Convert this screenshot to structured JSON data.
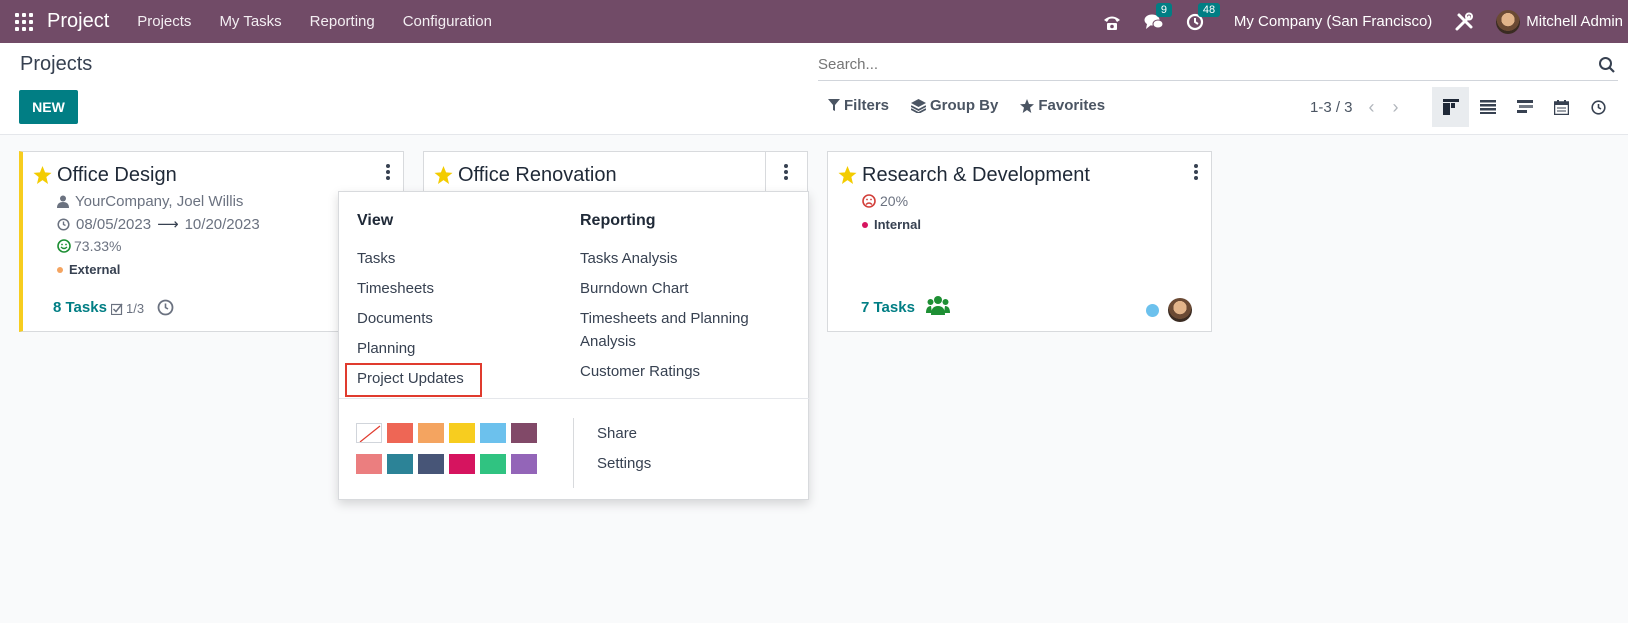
{
  "navbar": {
    "brand": "Project",
    "menu": [
      "Projects",
      "My Tasks",
      "Reporting",
      "Configuration"
    ],
    "messages_count": "9",
    "activities_count": "48",
    "company": "My Company (San Francisco)",
    "user": "Mitchell Admin",
    "color": "#714b67"
  },
  "control": {
    "title": "Projects",
    "new_label": "NEW",
    "search_placeholder": "Search...",
    "filters_label": "Filters",
    "groupby_label": "Group By",
    "favorites_label": "Favorites",
    "pager": "1-3 / 3"
  },
  "cards": [
    {
      "title": "Office Design",
      "customer": "YourCompany, Joel Willis",
      "date_start": "08/05/2023",
      "date_end": "10/20/2023",
      "rating": "73.33%",
      "tag": "External",
      "tasks": "8 Tasks",
      "milestones": "1/3"
    },
    {
      "title": "Office Renovation"
    },
    {
      "title": "Research & Development",
      "rating": "20%",
      "tag": "Internal",
      "tasks": "7 Tasks"
    }
  ],
  "dropdown": {
    "view_heading": "View",
    "view_items": [
      "Tasks",
      "Timesheets",
      "Documents",
      "Planning",
      "Project Updates"
    ],
    "reporting_heading": "Reporting",
    "reporting_items": [
      "Tasks Analysis",
      "Burndown Chart",
      "Timesheets and Planning Analysis",
      "Customer Ratings"
    ],
    "share_label": "Share",
    "settings_label": "Settings",
    "colors": [
      "#ffffff",
      "#ee6655",
      "#f4a460",
      "#f7cd1f",
      "#6cc1ed",
      "#814968",
      "#eb7e7f",
      "#2c8397",
      "#475577",
      "#d6145f",
      "#30c381",
      "#9365b8"
    ]
  },
  "accent": "#017e84"
}
